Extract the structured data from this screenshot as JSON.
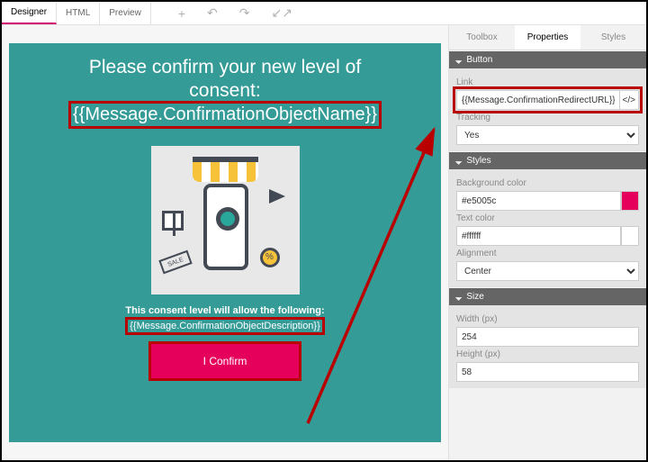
{
  "topTabs": {
    "designer": "Designer",
    "html": "HTML",
    "preview": "Preview"
  },
  "canvas": {
    "title1": "Please confirm your new level of",
    "title2": "consent:",
    "token_name": "{{Message.ConfirmationObjectName}}",
    "subtitle": "This consent level will allow the following:",
    "token_desc": "{{Message.ConfirmationObjectDescription}}",
    "confirm_label": "I Confirm",
    "sale": "SALE",
    "percent": "%"
  },
  "panelTabs": {
    "toolbox": "Toolbox",
    "properties": "Properties",
    "styles": "Styles"
  },
  "button": {
    "head": "Button",
    "link_label": "Link",
    "link_value": "{{Message.ConfirmationRedirectURL}}",
    "code_symbol": "</>",
    "tracking_label": "Tracking",
    "tracking_value": "Yes"
  },
  "styles": {
    "head": "Styles",
    "bg_label": "Background color",
    "bg_value": "#e5005c",
    "txt_label": "Text color",
    "txt_value": "#ffffff",
    "align_label": "Alignment",
    "align_value": "Center"
  },
  "size": {
    "head": "Size",
    "w_label": "Width (px)",
    "w_value": "254",
    "h_label": "Height (px)",
    "h_value": "58"
  }
}
